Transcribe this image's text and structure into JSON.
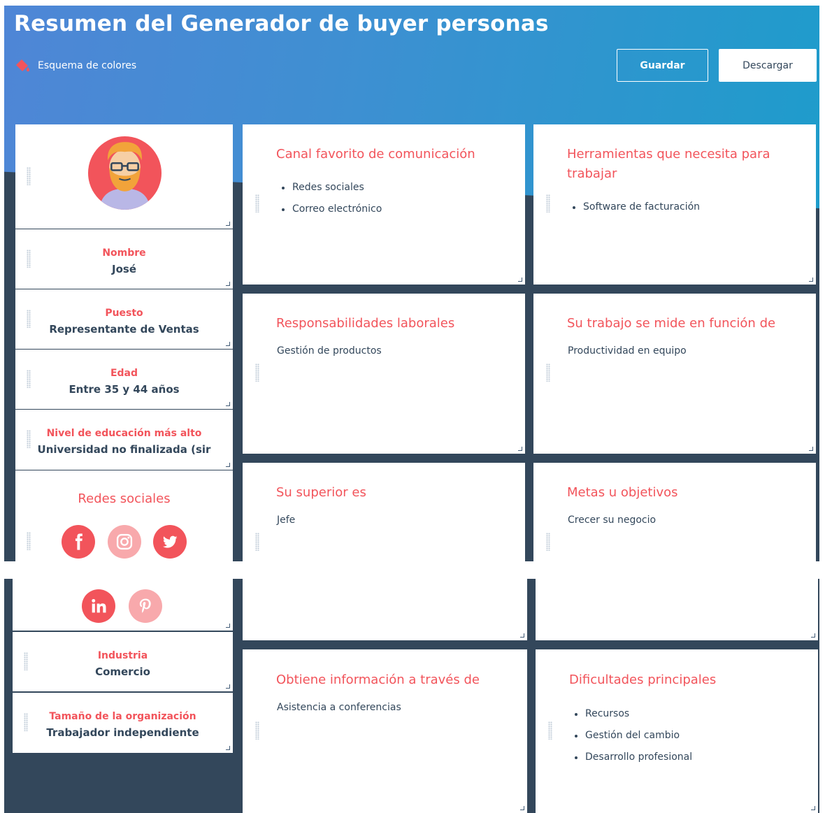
{
  "header": {
    "title": "Resumen del Generador de buyer personas",
    "color_scheme_label": "Esquema de colores",
    "save_label": "Guardar",
    "download_label": "Descargar"
  },
  "profile": {
    "name_label": "Nombre",
    "name_value": "José",
    "role_label": "Puesto",
    "role_value": "Representante de Ventas",
    "age_label": "Edad",
    "age_value": "Entre 35 y 44 años",
    "education_label": "Nivel de educación más alto",
    "education_value": "Universidad no finalizada (sir",
    "social_title": "Redes sociales",
    "social_networks": [
      "facebook",
      "instagram",
      "twitter",
      "linkedin",
      "pinterest"
    ],
    "industry_label": "Industria",
    "industry_value": "Comercio",
    "org_size_label": "Tamaño de la organización",
    "org_size_value": "Trabajador independiente"
  },
  "tiles": {
    "channel": {
      "title": "Canal favorito de comunicación",
      "items": [
        "Redes sociales",
        "Correo electrónico"
      ]
    },
    "tools": {
      "title": "Herramientas que necesita para trabajar",
      "items": [
        "Software de facturación"
      ]
    },
    "responsibilities": {
      "title": "Responsabilidades laborales",
      "text": "Gestión de productos"
    },
    "measured": {
      "title": "Su trabajo se mide en función de",
      "text": "Productividad en equipo"
    },
    "superior": {
      "title": "Su superior es",
      "text": "Jefe"
    },
    "goals": {
      "title": "Metas u objetivos",
      "text": "Crecer su negocio"
    },
    "info": {
      "title": "Obtiene información a través de",
      "text": "Asistencia a conferencias"
    },
    "challenges": {
      "title": "Dificultades principales",
      "items": [
        "Recursos",
        "Gestión del cambio",
        "Desarrollo profesional"
      ]
    }
  },
  "colors": {
    "accent": "#f2545b",
    "accent_soft": "#f8a9ac",
    "dark_bg": "#33475b",
    "header_gradient_start": "#4f86d6",
    "header_gradient_end": "#1e9ccb"
  }
}
